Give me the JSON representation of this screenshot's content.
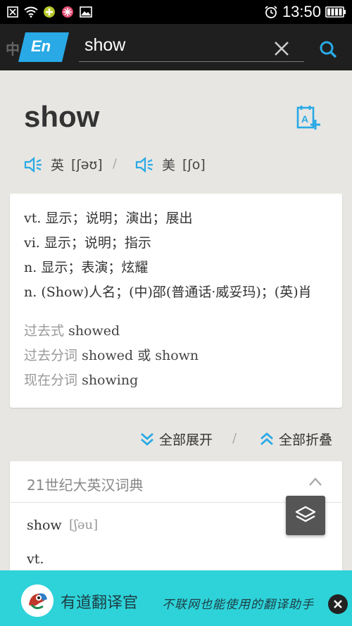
{
  "status_bar": {
    "time": "13:50",
    "icons": [
      "close-box-icon",
      "wifi-icon",
      "plus-circle-icon",
      "flower-icon",
      "image-icon",
      "alarm-icon",
      "battery-icon"
    ]
  },
  "search": {
    "lang_cn": "中",
    "lang_en": "En",
    "query": "show",
    "colors": {
      "accent": "#29a9e6",
      "bar": "#1f1f1f"
    }
  },
  "word": {
    "headword": "show",
    "uk_label": "英",
    "uk_phonetic": "[ʃəʊ]",
    "separator": "/",
    "us_label": "美",
    "us_phonetic": "[ʃo]"
  },
  "definitions": [
    "vt. 显示；说明；演出；展出",
    "vi. 显示；说明；指示",
    "n. 显示；表演；炫耀",
    "n. (Show)人名；(中)邵(普通话·威妥玛)；(英)肖"
  ],
  "forms": [
    {
      "label": "过去式",
      "value": "showed"
    },
    {
      "label": "过去分词",
      "value": "showed 或 shown"
    },
    {
      "label": "现在分词",
      "value": "showing"
    }
  ],
  "actions": {
    "expand_all": "全部展开",
    "separator": "/",
    "collapse_all": "全部折叠"
  },
  "dictionary": {
    "title": "21世纪大英汉词典",
    "word": "show",
    "phonetic": "[ʃəu]",
    "pos": "vt."
  },
  "ad": {
    "title": "有道翻译官",
    "slogan": "不联网也能使用的翻译助手"
  }
}
